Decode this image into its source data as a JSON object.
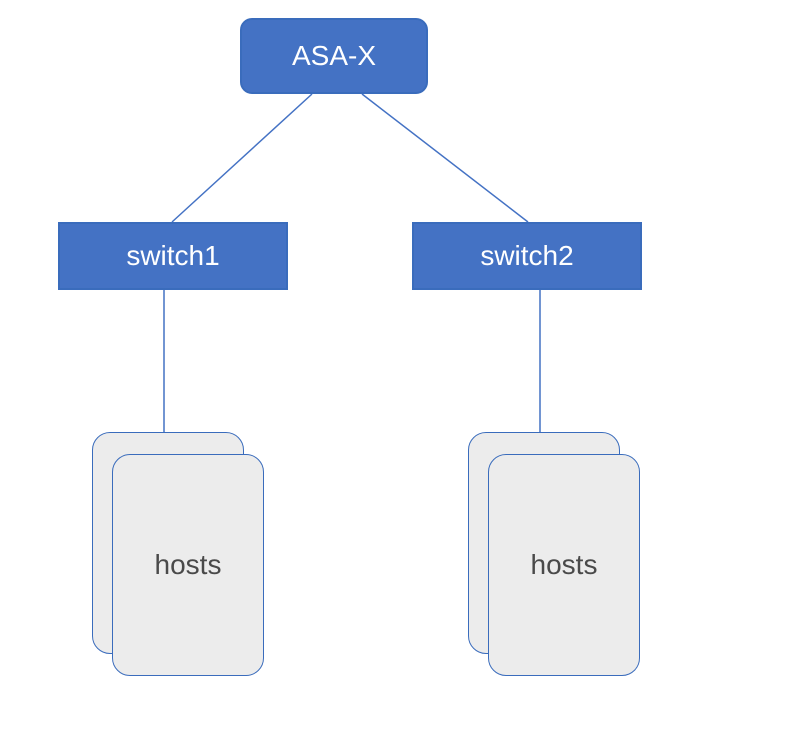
{
  "diagram": {
    "root": {
      "label": "ASA-X"
    },
    "switches": [
      {
        "label": "switch1"
      },
      {
        "label": "switch2"
      }
    ],
    "hosts": [
      {
        "label": "hosts"
      },
      {
        "label": "hosts"
      }
    ],
    "colors": {
      "node_fill": "#4472c4",
      "node_border": "#3a6cbc",
      "host_fill": "#ececec",
      "connector": "#4472c4",
      "text_on_blue": "#ffffff",
      "text_on_grey": "#4a4a4a"
    }
  }
}
